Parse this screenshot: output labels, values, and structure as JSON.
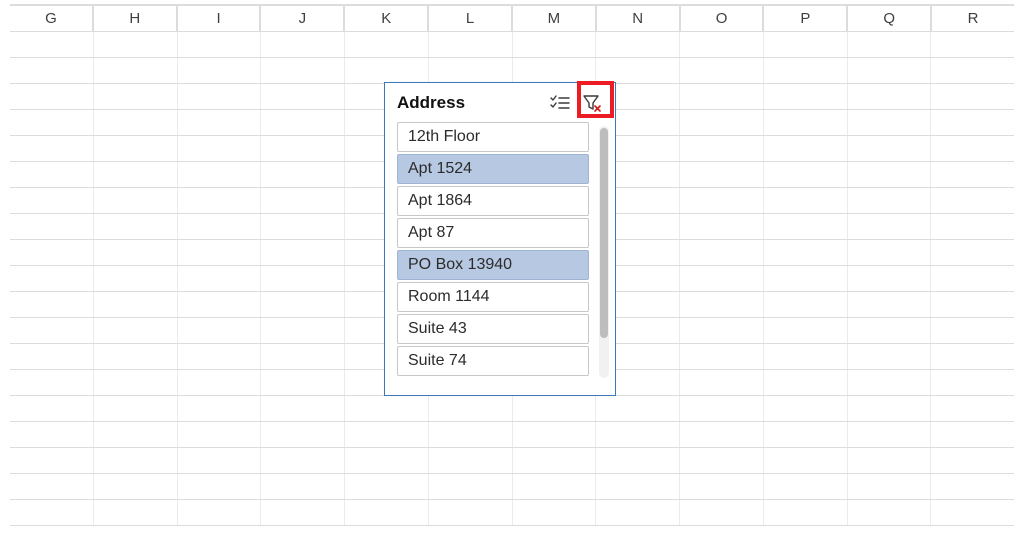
{
  "columns": [
    "G",
    "H",
    "I",
    "J",
    "K",
    "L",
    "M",
    "N",
    "O",
    "P",
    "Q",
    "R"
  ],
  "row_count": 19,
  "slicer": {
    "title": "Address",
    "items": [
      {
        "label": "12th Floor",
        "selected": false
      },
      {
        "label": "Apt 1524",
        "selected": true
      },
      {
        "label": "Apt 1864",
        "selected": false
      },
      {
        "label": "Apt 87",
        "selected": false
      },
      {
        "label": "PO Box 13940",
        "selected": true
      },
      {
        "label": "Room 1144",
        "selected": false
      },
      {
        "label": "Suite 43",
        "selected": false
      },
      {
        "label": "Suite 74",
        "selected": false
      }
    ],
    "icons": {
      "multi_select": "multi-select-icon",
      "clear_filter": "clear-filter-icon"
    },
    "highlight": "clear_filter"
  }
}
